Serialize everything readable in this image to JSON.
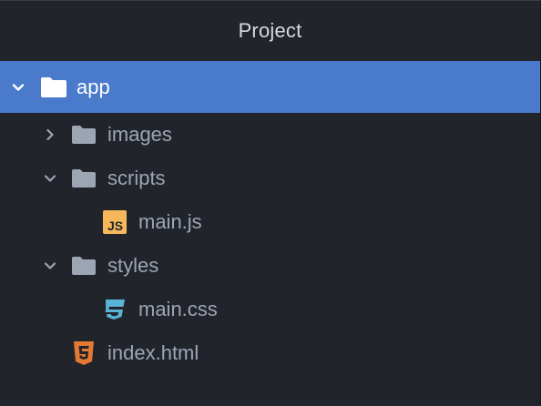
{
  "panel": {
    "title": "Project"
  },
  "tree": {
    "items": [
      {
        "label": "app",
        "type": "folder",
        "expanded": true,
        "selected": true,
        "icon": "folder-icon"
      },
      {
        "label": "images",
        "type": "folder",
        "expanded": false,
        "icon": "folder-icon"
      },
      {
        "label": "scripts",
        "type": "folder",
        "expanded": true,
        "icon": "folder-icon"
      },
      {
        "label": "main.js",
        "type": "file",
        "icon": "javascript-file-icon",
        "badge": "JS"
      },
      {
        "label": "styles",
        "type": "folder",
        "expanded": true,
        "icon": "folder-icon"
      },
      {
        "label": "main.css",
        "type": "file",
        "icon": "css3-file-icon"
      },
      {
        "label": "index.html",
        "type": "file",
        "icon": "html5-file-icon"
      }
    ]
  },
  "colors": {
    "background": "#21252b",
    "selection": "#4a7acc",
    "text": "#9da5b4",
    "folder_icon": "#9da5b4",
    "js_icon": "#f5b85a",
    "css_icon": "#5ab4d6",
    "html_icon": "#e37933"
  }
}
